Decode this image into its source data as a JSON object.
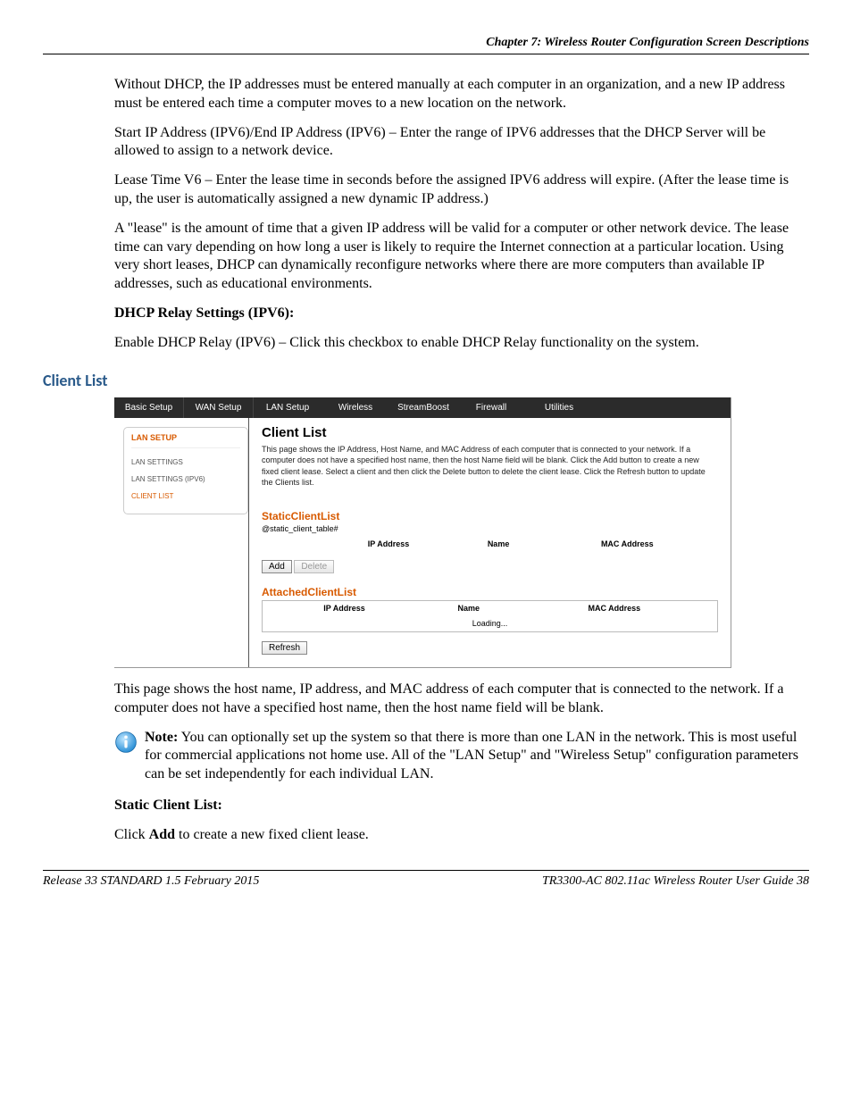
{
  "header": {
    "chapter": "Chapter 7: Wireless Router Configuration Screen Descriptions"
  },
  "para1": "Without DHCP, the IP addresses must be entered manually at each computer in an organization, and a new IP address must be entered each time a computer moves to a new location on the network.",
  "para2": "Start IP Address (IPV6)/End IP Address (IPV6) – Enter the range of IPV6 addresses that the DHCP Server will be allowed to assign to a network device.",
  "para3": "Lease Time V6  – Enter the lease time in seconds before the assigned IPV6 address will expire.  (After the lease time is up, the user is automatically assigned a new dynamic IP address.)",
  "para4": "A \"lease\" is the amount of time that a given IP address will be valid for a computer or other network device. The lease time can vary depending on how long a user is likely to require the Internet connection at a particular location.  Using very short leases, DHCP can dynamically reconfigure networks where there are more computers than available IP addresses, such as educational environments.",
  "heading_dhcp_relay": "DHCP Relay Settings (IPV6):",
  "para5": "Enable DHCP Relay (IPV6) – Click this checkbox to enable DHCP Relay functionality on the system.",
  "section_client_list": "Client List",
  "screenshot": {
    "tabs": [
      "Basic Setup",
      "WAN Setup",
      "LAN Setup",
      "Wireless",
      "StreamBoost",
      "Firewall",
      "Utilities"
    ],
    "sidebar": {
      "head": "LAN SETUP",
      "items": [
        "LAN SETTINGS",
        "LAN SETTINGS (IPV6)",
        "CLIENT LIST"
      ]
    },
    "panel": {
      "title": "Client List",
      "desc": "This page shows the IP Address, Host Name, and MAC Address of each computer that is connected to your network. If a computer does not have a specified host name, then the host Name field will be blank. Click the Add button to create a new fixed client lease. Select a client and then click the Delete button to delete the client lease. Click the Refresh button to update the Clients list.",
      "static_head": "StaticClientList",
      "static_sub": "@static_client_table#",
      "cols1": [
        "IP Address",
        "Name",
        "MAC Address"
      ],
      "add": "Add",
      "delete": "Delete",
      "attached_head": "AttachedClientList",
      "cols2": [
        "IP Address",
        "Name",
        "MAC Address"
      ],
      "loading": "Loading...",
      "refresh": "Refresh"
    }
  },
  "para6": "This page shows the host name, IP address, and MAC address of each computer that is connected to the network.  If a computer does not have a specified host name, then the host name field will be blank.",
  "note_label": "Note:",
  "note_body": "  You can optionally set up the system so that there is more than one LAN in the network.  This is most useful for commercial applications not home use.  All of the \"LAN Setup\" and \"Wireless Setup\" configuration parameters can be set independently for each individual LAN.",
  "heading_static": "Static Client List:",
  "para7_a": "Click ",
  "para7_b": "Add",
  "para7_c": " to create a new fixed client lease.",
  "footer": {
    "left": "Release 33 STANDARD 1.5    February 2015",
    "right": "TR3300-AC 802.11ac Wireless Router User Guide    38"
  }
}
